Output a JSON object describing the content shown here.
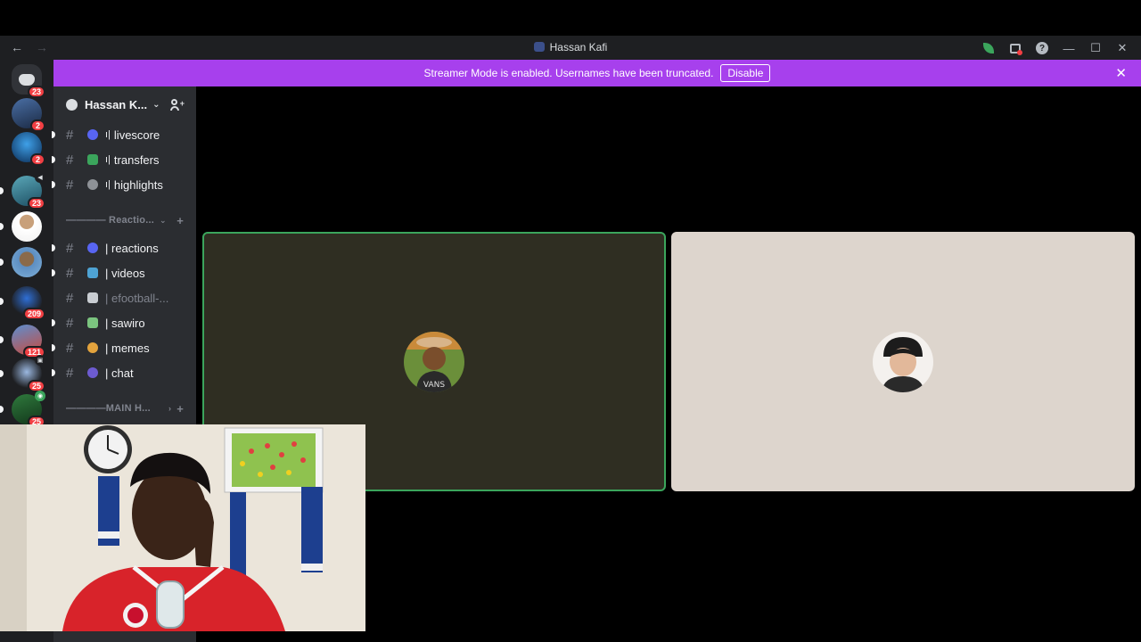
{
  "titlebar": {
    "title": "Hassan Kafi",
    "back": "←",
    "forward": "→"
  },
  "banner": {
    "message": "Streamer Mode is enabled. Usernames have been truncated.",
    "disable_label": "Disable",
    "close": "✕"
  },
  "guilds": [
    {
      "badge": "23"
    },
    {
      "badge": "2"
    },
    {
      "badge": "2"
    },
    {
      "badge": "23"
    },
    {
      "badge": ""
    },
    {
      "badge": ""
    },
    {
      "badge": "209"
    },
    {
      "badge": "121"
    },
    {
      "badge": "25"
    },
    {
      "badge": "25"
    }
  ],
  "server": {
    "name": "Hassan K...",
    "chevron": "⌄",
    "channels_top": [
      {
        "name": "livescore",
        "prefix": "ı|",
        "emoji_color": "#5865f2"
      },
      {
        "name": "transfers",
        "prefix": "ı|",
        "emoji_color": "#3ba55c"
      },
      {
        "name": "highlights",
        "prefix": "ı|",
        "emoji_color": "#8e9297"
      }
    ],
    "category_reactions": "———— Reactio...",
    "channels_reactions": [
      {
        "name": "| reactions",
        "emoji_color": "#5865f2"
      },
      {
        "name": "| videos",
        "emoji_color": "#4ea3d4"
      },
      {
        "name": "| efootball-...",
        "emoji_color": "#c9cdd2"
      },
      {
        "name": "| sawiro",
        "emoji_color": "#7bc47f"
      },
      {
        "name": "| memes",
        "emoji_color": "#e3a33d"
      },
      {
        "name": "| chat",
        "emoji_color": "#6d5bd0"
      }
    ],
    "category_main": "————MAIN H..."
  },
  "colors": {
    "banner": "#a740ed",
    "speaking": "#3ba55c",
    "badge": "#f23f43"
  }
}
